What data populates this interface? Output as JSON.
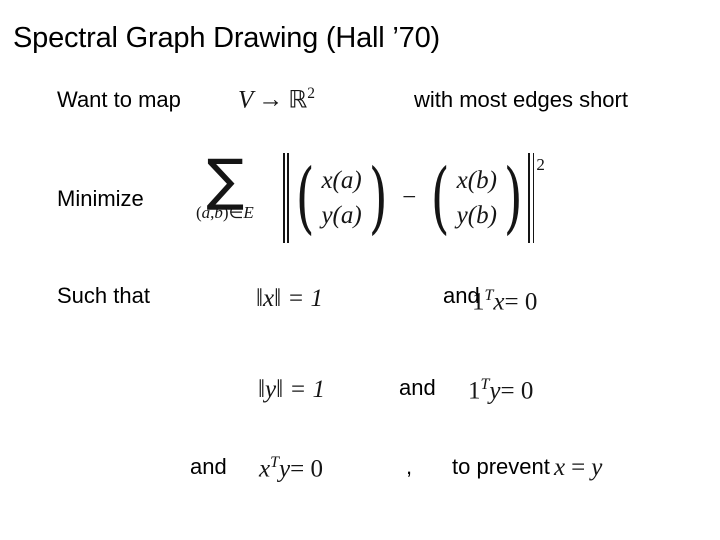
{
  "slide": {
    "title": "Spectral Graph Drawing (Hall ’70)",
    "background_color": "#ffffff",
    "text_color": "#000000",
    "math_color": "#151515"
  },
  "line1": {
    "label": "Want to map",
    "math": {
      "domain": "V",
      "arrow": "→",
      "codomain": "ℝ",
      "codomain_exponent": "2"
    },
    "trailing_label": "with most edges short"
  },
  "line2": {
    "label": "Minimize",
    "sum": {
      "symbol": "∑",
      "subscript_open": "(",
      "subscript_a": "a",
      "subscript_comma": ",",
      "subscript_b": "b",
      "subscript_close": ")",
      "subscript_in": "∈",
      "subscript_set": "E"
    },
    "vector_left": {
      "row1": "x(a)",
      "row2": "y(a)"
    },
    "operator": "−",
    "vector_right": {
      "row1": "x(b)",
      "row2": "y(b)"
    },
    "norm_exponent": "2",
    "paren_open": "(",
    "paren_close": ")"
  },
  "line3": {
    "label": "Such that",
    "constraint_norm_x": "‖x‖ = 1",
    "connector": "and",
    "constraint_one_t_x": {
      "vector": "1",
      "transpose": "T",
      "variable": "x",
      "relation": "= 0"
    }
  },
  "line4": {
    "constraint_norm_y": "‖y‖ = 1",
    "connector": "and",
    "constraint_one_t_y": {
      "vector": "1",
      "transpose": "T",
      "variable": "y",
      "relation": "= 0"
    }
  },
  "line5": {
    "connector": "and",
    "constraint_x_t_y": {
      "variable": "x",
      "transpose": "T",
      "variable2": "y",
      "relation": "= 0"
    },
    "comma": ",",
    "reason_label": "to prevent",
    "degenerate": {
      "left": "x",
      "relation": "=",
      "right": "y"
    }
  }
}
